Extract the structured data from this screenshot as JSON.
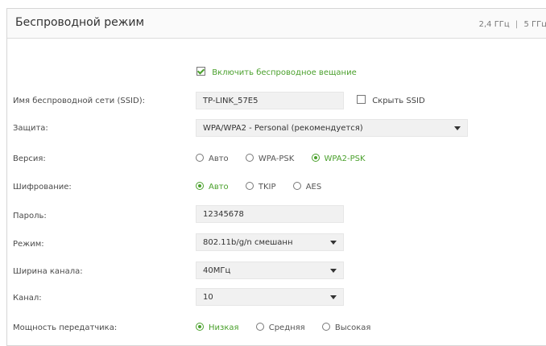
{
  "header": {
    "title": "Беспроводной режим",
    "band_24": "2,4 ГГц",
    "separator": "|",
    "band_5": "5 ГГц"
  },
  "enable_wireless": {
    "label": "Включить беспроводное вещание",
    "checked": true
  },
  "ssid": {
    "label": "Имя беспроводной сети (SSID):",
    "value": "TP-LINK_57E5",
    "hide_label": "Скрыть SSID",
    "hide_checked": false
  },
  "security": {
    "label": "Защита:",
    "value": "WPA/WPA2 - Personal (рекомендуется)"
  },
  "version": {
    "label": "Версия:",
    "options": [
      "Авто",
      "WPA-PSK",
      "WPA2-PSK"
    ],
    "selected": "WPA2-PSK"
  },
  "encryption": {
    "label": "Шифрование:",
    "options": [
      "Авто",
      "TKIP",
      "AES"
    ],
    "selected": "Авто"
  },
  "password": {
    "label": "Пароль:",
    "value": "12345678"
  },
  "mode": {
    "label": "Режим:",
    "value": "802.11b/g/n смешанн"
  },
  "channel_width": {
    "label": "Ширина канала:",
    "value": "40МГц"
  },
  "channel": {
    "label": "Канал:",
    "value": "10"
  },
  "tx_power": {
    "label": "Мощность передатчика:",
    "options": [
      "Низкая",
      "Средняя",
      "Высокая"
    ],
    "selected": "Низкая"
  },
  "colors": {
    "accent": "#4aa02c",
    "field_bg": "#f1f1f1",
    "border": "#d6d6d6"
  }
}
